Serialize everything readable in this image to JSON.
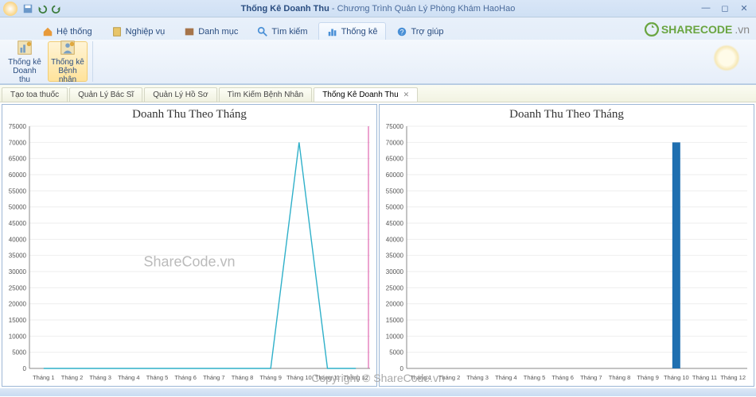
{
  "window": {
    "title_prefix": "Thống Kê Doanh Thu",
    "title_suffix": "Chương Trình Quản Lý Phòng Khám HaoHao"
  },
  "logo": {
    "brand": "SHARECODE",
    "tld": ".vn"
  },
  "ribbon_tabs": [
    {
      "label": "Hệ thống"
    },
    {
      "label": "Nghiệp vụ"
    },
    {
      "label": "Danh mục"
    },
    {
      "label": "Tìm kiếm"
    },
    {
      "label": "Thống kê"
    },
    {
      "label": "Trợ giúp"
    }
  ],
  "ribbon_buttons": [
    {
      "label": "Thống kê Doanh thu"
    },
    {
      "label": "Thống kê Bệnh nhân"
    }
  ],
  "sub_tabs": [
    {
      "label": "Tạo toa thuốc"
    },
    {
      "label": "Quản Lý Bác Sĩ"
    },
    {
      "label": "Quản Lý Hồ Sơ"
    },
    {
      "label": "Tìm Kiếm Bệnh Nhân"
    },
    {
      "label": "Thống Kê Doanh Thu",
      "closable": true
    }
  ],
  "watermarks": {
    "center": "ShareCode.vn",
    "bottom": "Copyright © ShareCode.vn"
  },
  "chart_data": [
    {
      "type": "line",
      "title": "Doanh Thu Theo Tháng",
      "xlabel": "",
      "ylabel": "",
      "ylim": [
        0,
        75000
      ],
      "y_ticks": [
        0,
        5000,
        10000,
        15000,
        20000,
        25000,
        30000,
        35000,
        40000,
        45000,
        50000,
        55000,
        60000,
        65000,
        70000,
        75000
      ],
      "categories": [
        "Tháng 1",
        "Tháng 2",
        "Tháng 3",
        "Tháng 4",
        "Tháng 5",
        "Tháng 6",
        "Tháng 7",
        "Tháng 8",
        "Tháng 9",
        "Tháng 10",
        "Tháng 11",
        "Tháng 12"
      ],
      "values": [
        0,
        0,
        0,
        0,
        0,
        0,
        0,
        0,
        0,
        70000,
        0,
        0
      ]
    },
    {
      "type": "bar",
      "title": "Doanh Thu Theo Tháng",
      "xlabel": "",
      "ylabel": "",
      "ylim": [
        0,
        75000
      ],
      "y_ticks": [
        0,
        5000,
        10000,
        15000,
        20000,
        25000,
        30000,
        35000,
        40000,
        45000,
        50000,
        55000,
        60000,
        65000,
        70000,
        75000
      ],
      "categories": [
        "Tháng 1",
        "Tháng 2",
        "Tháng 3",
        "Tháng 4",
        "Tháng 5",
        "Tháng 6",
        "Tháng 7",
        "Tháng 8",
        "Tháng 9",
        "Tháng 10",
        "Tháng 11",
        "Tháng 12"
      ],
      "values": [
        0,
        0,
        0,
        0,
        0,
        0,
        0,
        0,
        0,
        70000,
        0,
        0
      ]
    }
  ]
}
